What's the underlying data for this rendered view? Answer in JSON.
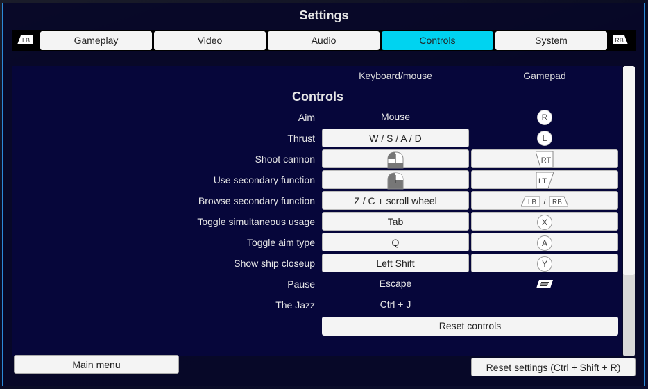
{
  "title": "Settings",
  "tabs": {
    "prev_bumper": "LB",
    "next_bumper": "RB",
    "items": [
      {
        "label": "Gameplay",
        "active": false
      },
      {
        "label": "Video",
        "active": false
      },
      {
        "label": "Audio",
        "active": false
      },
      {
        "label": "Controls",
        "active": true
      },
      {
        "label": "System",
        "active": false
      }
    ]
  },
  "columns": {
    "keyboard": "Keyboard/mouse",
    "gamepad": "Gamepad"
  },
  "section_title": "Controls",
  "controls": [
    {
      "label": "Aim",
      "keyboard": "Mouse",
      "keyboard_editable": false,
      "gamepad_icon": "right-stick-icon",
      "gamepad_glyph": "R",
      "gamepad_editable": false
    },
    {
      "label": "Thrust",
      "keyboard": "W / S / A / D",
      "keyboard_editable": true,
      "gamepad_icon": "left-stick-icon",
      "gamepad_glyph": "L",
      "gamepad_editable": false
    },
    {
      "label": "Shoot cannon",
      "keyboard_icon": "left-mouse-button-icon",
      "keyboard_editable": true,
      "gamepad_icon": "right-trigger-icon",
      "gamepad_glyph": "RT",
      "gamepad_editable": true
    },
    {
      "label": "Use secondary function",
      "keyboard_icon": "right-mouse-button-icon",
      "keyboard_editable": true,
      "gamepad_icon": "left-trigger-icon",
      "gamepad_glyph": "LT",
      "gamepad_editable": true
    },
    {
      "label": "Browse secondary function",
      "keyboard": "Z / C + scroll wheel",
      "keyboard_editable": true,
      "gamepad_icon": "bumpers-icon",
      "gamepad_glyph": "LB / RB",
      "gamepad_editable": true
    },
    {
      "label": "Toggle simultaneous usage",
      "keyboard": "Tab",
      "keyboard_editable": true,
      "gamepad_icon": "x-button-icon",
      "gamepad_glyph": "X",
      "gamepad_editable": true
    },
    {
      "label": "Toggle aim type",
      "keyboard": "Q",
      "keyboard_editable": true,
      "gamepad_icon": "a-button-icon",
      "gamepad_glyph": "A",
      "gamepad_editable": true
    },
    {
      "label": "Show ship closeup",
      "keyboard": "Left Shift",
      "keyboard_editable": true,
      "gamepad_icon": "y-button-icon",
      "gamepad_glyph": "Y",
      "gamepad_editable": true
    },
    {
      "label": "Pause",
      "keyboard": "Escape",
      "keyboard_editable": false,
      "gamepad_icon": "menu-button-icon",
      "gamepad_editable": false
    },
    {
      "label": "The Jazz",
      "keyboard": "Ctrl + J",
      "keyboard_editable": false,
      "gamepad_editable": false
    }
  ],
  "reset_controls_label": "Reset controls",
  "main_menu_label": "Main menu",
  "reset_settings_label": "Reset settings (Ctrl + Shift + R)",
  "scroll_fraction_visible": 0.72,
  "colors": {
    "active_tab": "#00d3f0",
    "frame_border": "#2c8ad8"
  }
}
